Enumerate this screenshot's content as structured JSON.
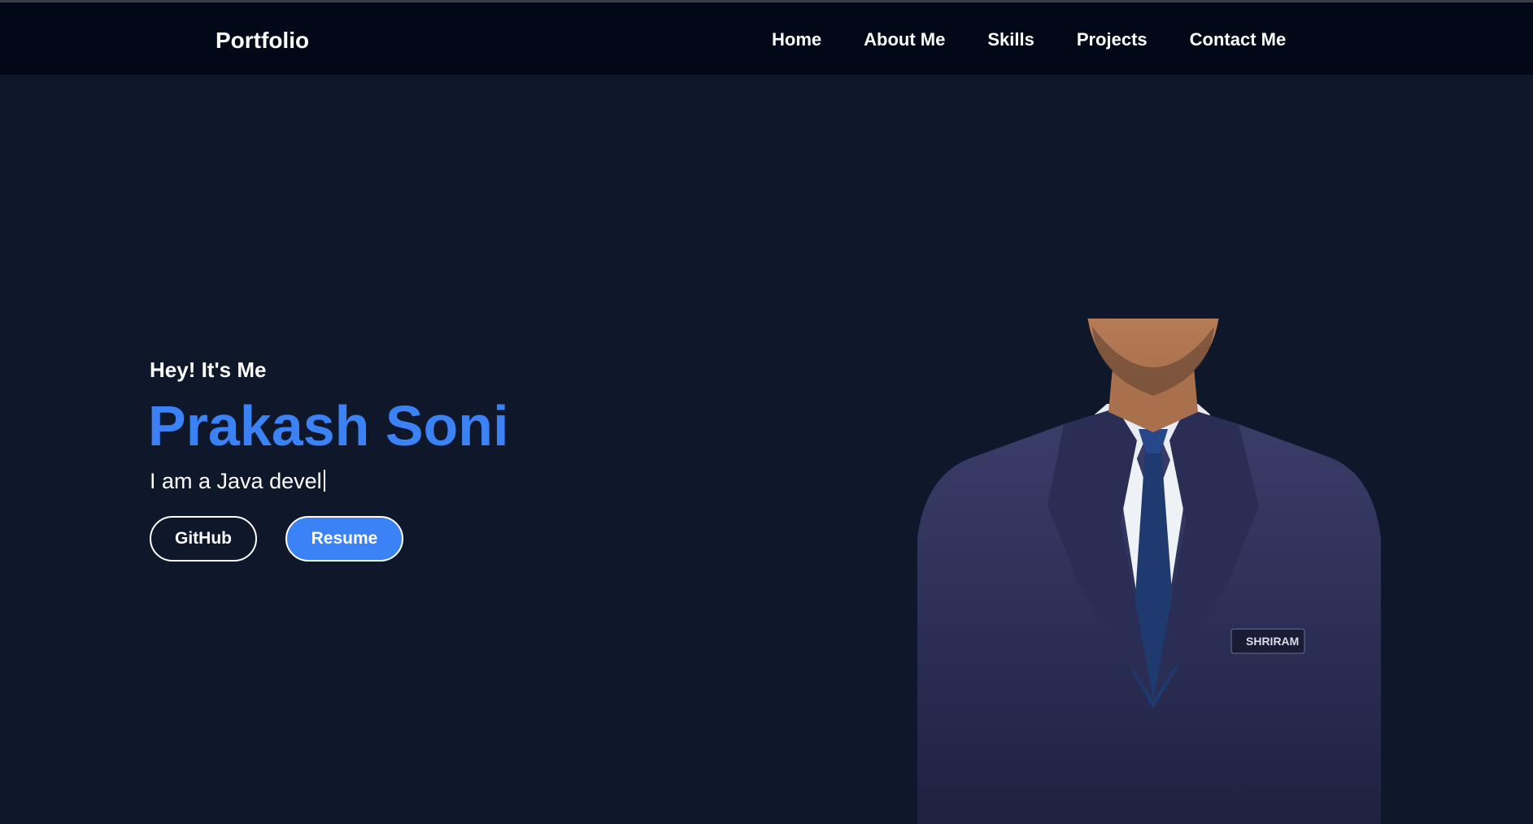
{
  "navbar": {
    "brand": "Portfolio",
    "links": [
      {
        "label": "Home"
      },
      {
        "label": "About Me"
      },
      {
        "label": "Skills"
      },
      {
        "label": "Projects"
      },
      {
        "label": "Contact Me"
      }
    ]
  },
  "hero": {
    "greeting": "Hey! It's Me",
    "name": "Prakash Soni",
    "typed_text": "I am a Java devel",
    "buttons": {
      "github": "GitHub",
      "resume": "Resume"
    },
    "portrait": {
      "badge_text": "SHRIRAM"
    }
  },
  "colors": {
    "background": "#0f172a",
    "navbar": "#020817",
    "accent": "#3b82f6",
    "text": "#ffffff"
  }
}
